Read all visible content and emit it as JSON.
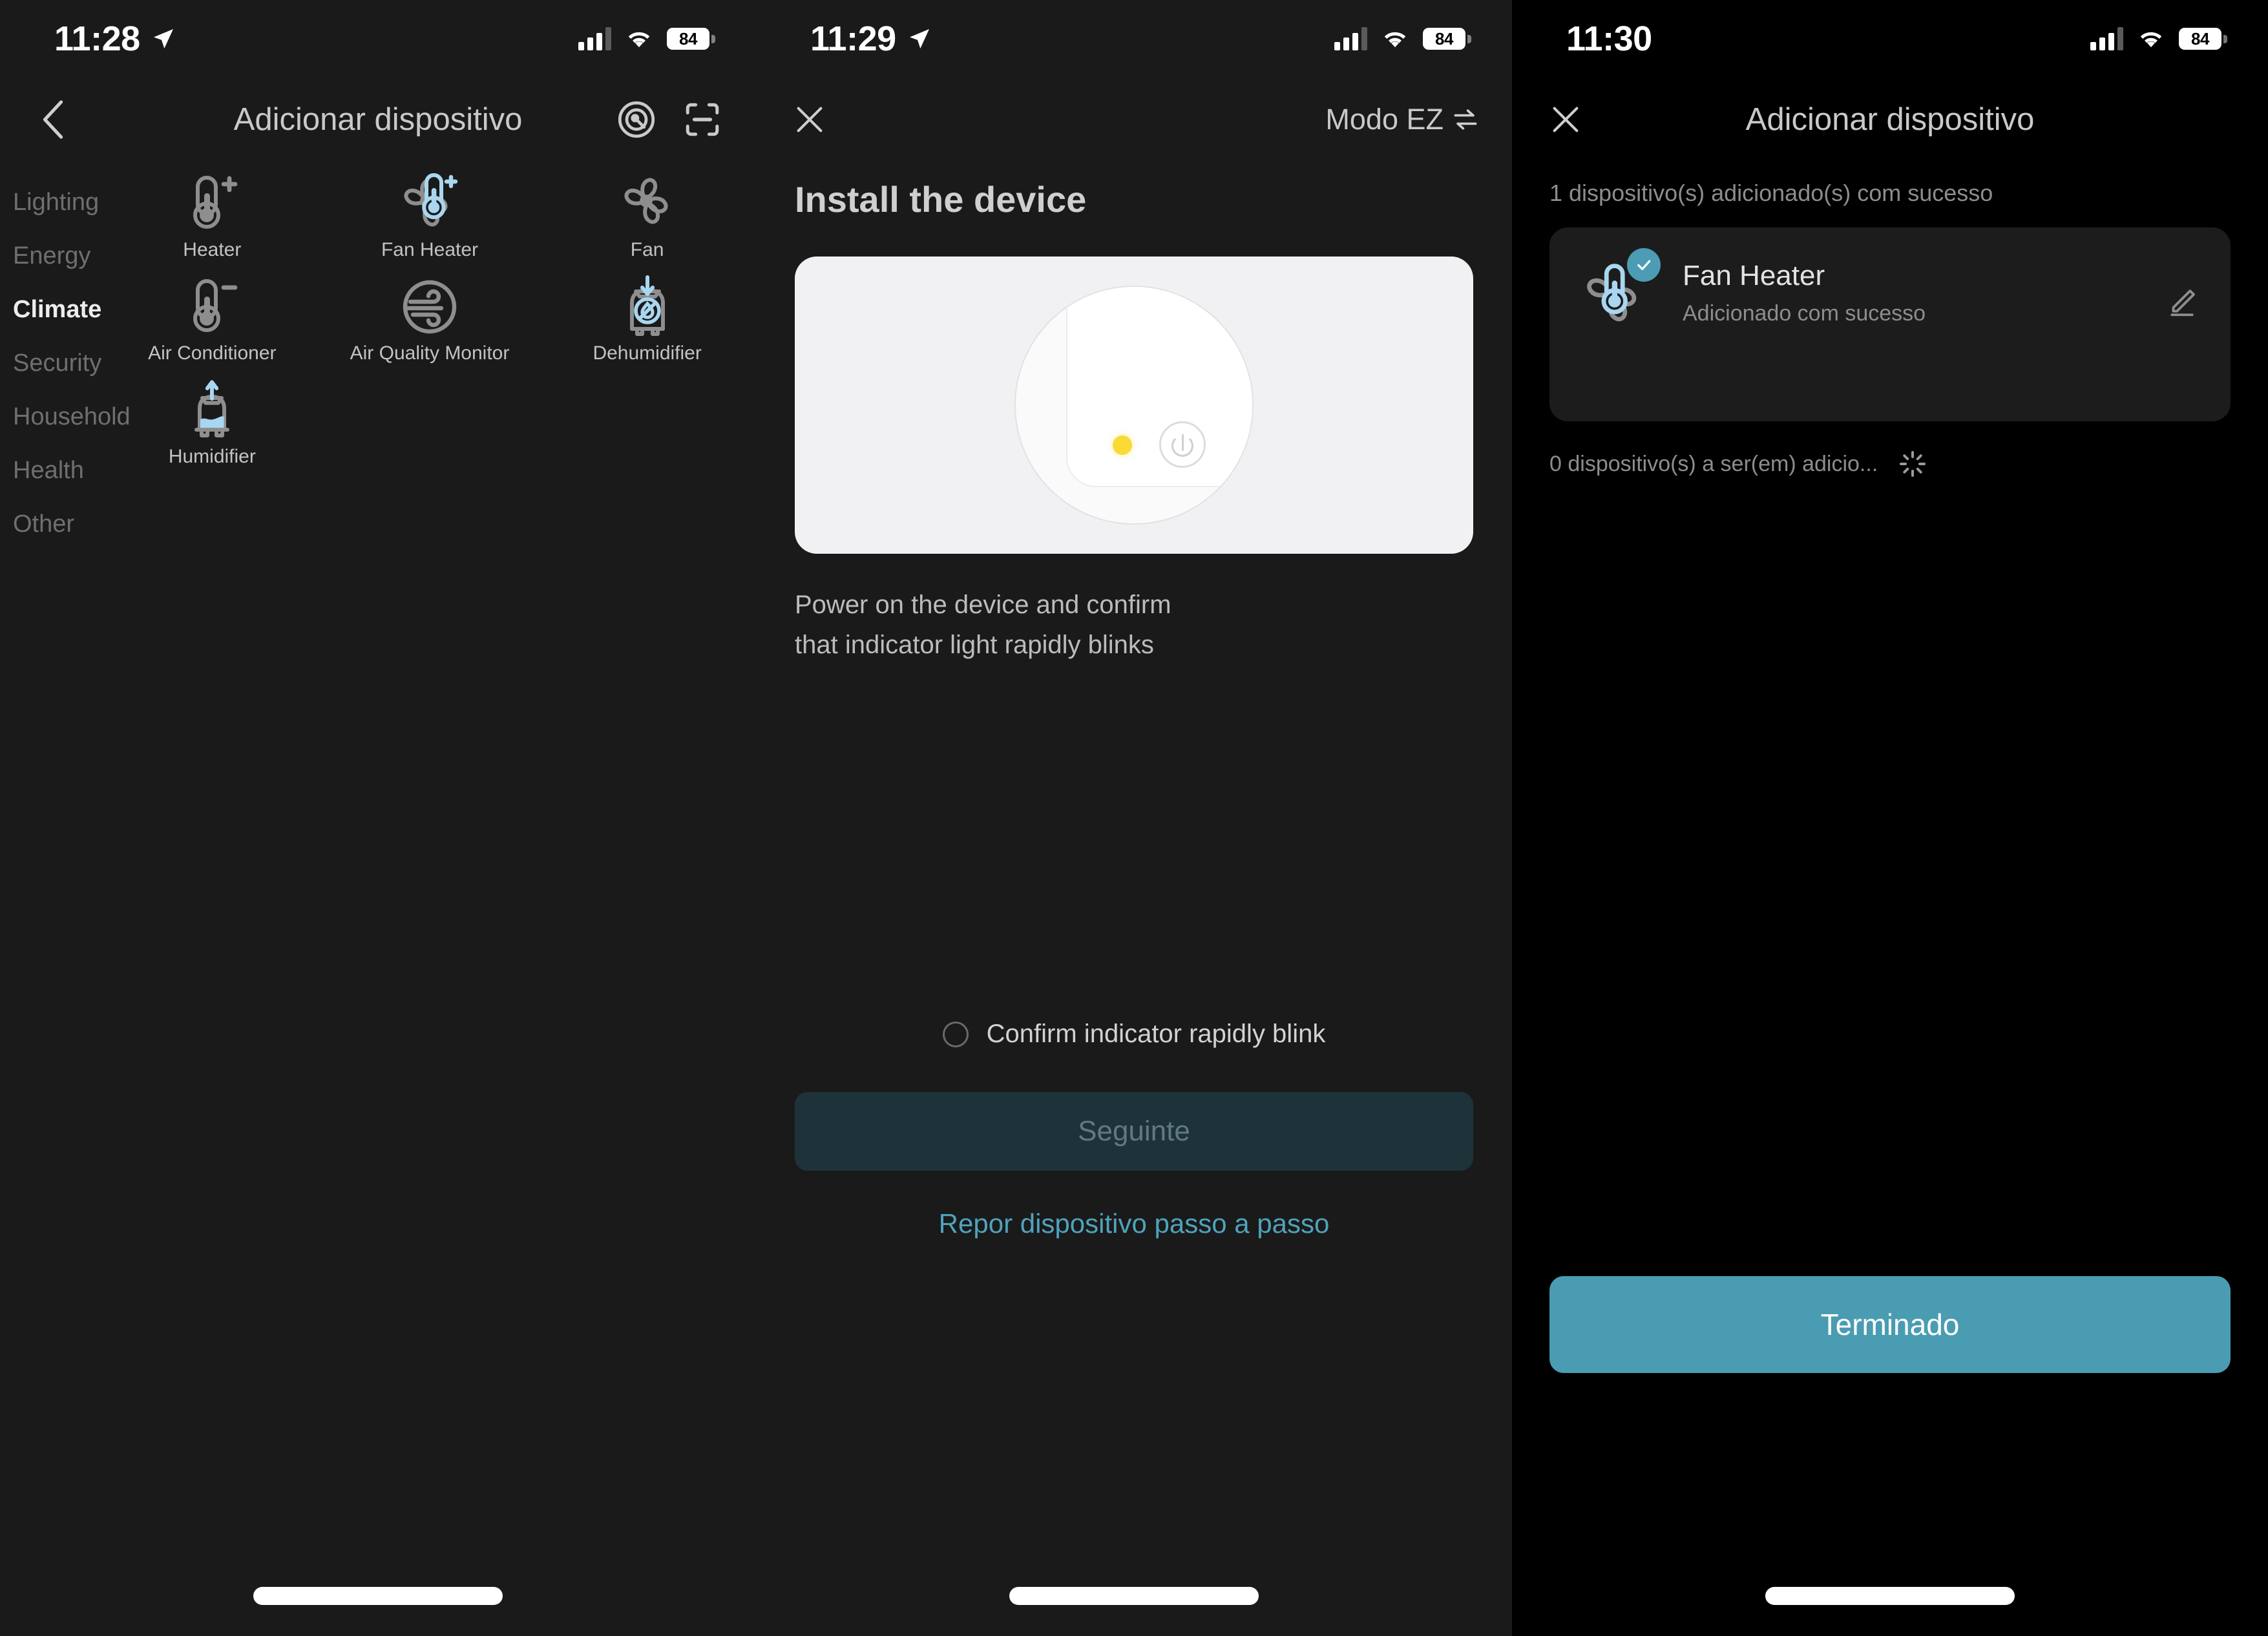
{
  "colors": {
    "panel_bg_dark": "#1a1a1a",
    "panel_bg_black": "#000000",
    "accent_teal": "#4a9cb2",
    "link_blue": "#4fa3bb",
    "icon_gray": "#8e8e8e",
    "icon_blue": "#a9d6f0",
    "led_yellow": "#fada35",
    "next_button_bg": "#1e3339"
  },
  "panel1": {
    "status": {
      "time": "11:28",
      "location_icon": "location-arrow-icon",
      "battery": "84",
      "wifi_icon": "wifi-icon",
      "signal_icon": "cellular-signal-icon"
    },
    "nav": {
      "back_icon": "chevron-left-icon",
      "title": "Adicionar dispositivo",
      "radar_icon": "radar-scan-icon",
      "qr_icon": "qr-scan-icon"
    },
    "categories": [
      {
        "label": "Lighting",
        "active": false
      },
      {
        "label": "Energy",
        "active": false
      },
      {
        "label": "Climate",
        "active": true
      },
      {
        "label": "Security",
        "active": false
      },
      {
        "label": "Household",
        "active": false
      },
      {
        "label": "Health",
        "active": false
      },
      {
        "label": "Other",
        "active": false
      }
    ],
    "devices": [
      {
        "label": "Heater",
        "icon": "thermometer-plus-icon"
      },
      {
        "label": "Fan Heater",
        "icon": "fan-thermometer-plus-icon"
      },
      {
        "label": "Fan",
        "icon": "fan-icon"
      },
      {
        "label": "Air Conditioner",
        "icon": "thermometer-minus-icon"
      },
      {
        "label": "Air Quality Monitor",
        "icon": "air-quality-icon"
      },
      {
        "label": "Dehumidifier",
        "icon": "dehumidifier-icon"
      },
      {
        "label": "Humidifier",
        "icon": "humidifier-icon"
      }
    ]
  },
  "panel2": {
    "status": {
      "time": "11:29",
      "location_icon": "location-arrow-icon",
      "battery": "84"
    },
    "nav": {
      "close_icon": "close-x-icon",
      "mode_label": "Modo EZ",
      "mode_swap_icon": "swap-arrows-icon"
    },
    "heading": "Install the device",
    "description_line1": "Power on the device and confirm",
    "description_line2": "that indicator light rapidly blinks",
    "confirm_label": "Confirm indicator rapidly blink",
    "next_button": "Seguinte",
    "reset_link": "Repor dispositivo passo a passo"
  },
  "panel3": {
    "status": {
      "time": "11:30",
      "battery": "84"
    },
    "nav": {
      "close_icon": "close-x-icon",
      "title": "Adicionar dispositivo"
    },
    "success_count_text": "1 dispositivo(s) adicionado(s) com sucesso",
    "device": {
      "name": "Fan Heater",
      "status": "Adicionado com sucesso",
      "icon": "fan-thermometer-icon",
      "badge_icon": "check-badge-icon",
      "edit_icon": "pencil-edit-icon"
    },
    "pending_text": "0 dispositivo(s) a ser(em) adicio...",
    "spinner_icon": "loading-spinner-icon",
    "done_button": "Terminado"
  }
}
